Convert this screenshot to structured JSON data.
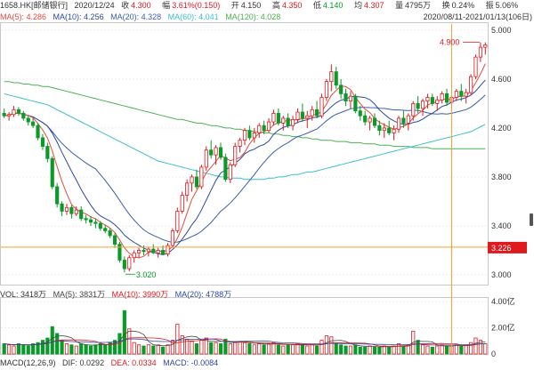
{
  "header": {
    "code": "1658.HK[邮储银行]",
    "date": "2020/12/24",
    "close_label": "收",
    "close": "4.300",
    "change_label": "幅",
    "change": "3.61%(0.150)",
    "open_label": "开",
    "open": "4.150",
    "high_label": "高",
    "high": "4.350",
    "low_label": "低",
    "low": "4.140",
    "avg_label": "均",
    "avg": "4.307",
    "volume_label": "量",
    "volume": "4795万",
    "turnover_label": "换",
    "turnover": "0.24%",
    "amplitude_label": "振",
    "amplitude": "5.06%"
  },
  "ma_legend": {
    "ma5": "MA(5): 4.286",
    "ma10": "MA(10): 4.256",
    "ma20": "MA(20): 4.328",
    "ma60": "MA(60): 4.041",
    "ma120": "MA(120): 4.028"
  },
  "range_label": "2020/08/11-2021/01/13(106日)",
  "annotations": {
    "high_label": "4.900",
    "low_label": "3.020",
    "crosshair_label": "3.226"
  },
  "vol_legend": {
    "vol": "VOL: 3418万",
    "ma5": "MA(5): 3831万",
    "ma10": "MA(10): 3990万",
    "ma20": "MA(20): 4788万"
  },
  "macd_legend": {
    "macd": "MACD(12,26,9)",
    "dif": "DIF: 0.0292",
    "dea": "DEA: 0.0334",
    "macd_val": "MACD: -0.0084"
  },
  "colors": {
    "up": "#e0191e",
    "down": "#0a9a2a",
    "ma5": "#e74c3c",
    "ma10": "#2c4aa0",
    "ma20": "#3b5fb0",
    "ma60": "#3cbfd0",
    "ma120": "#4cb050",
    "crosshair": "#f0a030"
  },
  "chart_data": {
    "type": "candlestick",
    "y_ticks": [
      "5.000",
      "4.600",
      "4.200",
      "3.800",
      "3.400",
      "3.000"
    ],
    "ylim": [
      2.92,
      5.05
    ],
    "vol_ticks": [
      "4.00亿",
      "2.00亿",
      "0"
    ],
    "vol_max": 4.6,
    "candles": [
      [
        4.32,
        4.36,
        4.28,
        4.3
      ],
      [
        4.3,
        4.33,
        4.26,
        4.31
      ],
      [
        4.31,
        4.38,
        4.29,
        4.35
      ],
      [
        4.35,
        4.37,
        4.3,
        4.32
      ],
      [
        4.32,
        4.34,
        4.26,
        4.28
      ],
      [
        4.28,
        4.3,
        4.22,
        4.25
      ],
      [
        4.25,
        4.28,
        4.2,
        4.22
      ],
      [
        4.22,
        4.24,
        4.1,
        4.12
      ],
      [
        4.12,
        4.15,
        4.02,
        4.05
      ],
      [
        4.05,
        4.08,
        3.92,
        3.95
      ],
      [
        3.95,
        3.97,
        3.7,
        3.72
      ],
      [
        3.72,
        3.75,
        3.55,
        3.58
      ],
      [
        3.58,
        3.6,
        3.48,
        3.52
      ],
      [
        3.52,
        3.58,
        3.49,
        3.55
      ],
      [
        3.55,
        3.57,
        3.46,
        3.5
      ],
      [
        3.5,
        3.56,
        3.48,
        3.53
      ],
      [
        3.53,
        3.56,
        3.44,
        3.46
      ],
      [
        3.46,
        3.49,
        3.42,
        3.45
      ],
      [
        3.45,
        3.48,
        3.4,
        3.43
      ],
      [
        3.43,
        3.46,
        3.38,
        3.42
      ],
      [
        3.42,
        3.44,
        3.36,
        3.38
      ],
      [
        3.38,
        3.41,
        3.34,
        3.36
      ],
      [
        3.36,
        3.38,
        3.3,
        3.32
      ],
      [
        3.32,
        3.34,
        3.22,
        3.25
      ],
      [
        3.25,
        3.27,
        3.1,
        3.12
      ],
      [
        3.12,
        3.15,
        3.02,
        3.05
      ],
      [
        3.05,
        3.16,
        3.03,
        3.14
      ],
      [
        3.14,
        3.2,
        3.1,
        3.18
      ],
      [
        3.18,
        3.22,
        3.14,
        3.2
      ],
      [
        3.2,
        3.24,
        3.16,
        3.19
      ],
      [
        3.19,
        3.23,
        3.15,
        3.21
      ],
      [
        3.21,
        3.25,
        3.17,
        3.18
      ],
      [
        3.18,
        3.22,
        3.14,
        3.2
      ],
      [
        3.2,
        3.24,
        3.16,
        3.17
      ],
      [
        3.17,
        3.26,
        3.15,
        3.24
      ],
      [
        3.24,
        3.38,
        3.22,
        3.36
      ],
      [
        3.36,
        3.55,
        3.34,
        3.52
      ],
      [
        3.52,
        3.68,
        3.5,
        3.65
      ],
      [
        3.65,
        3.78,
        3.6,
        3.75
      ],
      [
        3.75,
        3.82,
        3.68,
        3.8
      ],
      [
        3.8,
        3.86,
        3.7,
        3.72
      ],
      [
        3.72,
        3.9,
        3.7,
        3.88
      ],
      [
        3.88,
        4.05,
        3.85,
        4.02
      ],
      [
        4.02,
        4.1,
        3.95,
        3.98
      ],
      [
        3.98,
        4.06,
        3.9,
        4.04
      ],
      [
        4.04,
        4.08,
        3.94,
        3.96
      ],
      [
        3.96,
        3.99,
        3.76,
        3.78
      ],
      [
        3.78,
        3.92,
        3.75,
        3.9
      ],
      [
        3.9,
        4.08,
        3.88,
        4.05
      ],
      [
        4.05,
        4.12,
        4.0,
        4.1
      ],
      [
        4.1,
        4.2,
        4.06,
        4.18
      ],
      [
        4.18,
        4.22,
        4.1,
        4.12
      ],
      [
        4.12,
        4.2,
        4.08,
        4.16
      ],
      [
        4.16,
        4.24,
        4.12,
        4.22
      ],
      [
        4.22,
        4.26,
        4.15,
        4.18
      ],
      [
        4.18,
        4.28,
        4.16,
        4.25
      ],
      [
        4.25,
        4.35,
        4.22,
        4.32
      ],
      [
        4.32,
        4.36,
        4.22,
        4.24
      ],
      [
        4.24,
        4.3,
        4.18,
        4.28
      ],
      [
        4.28,
        4.32,
        4.2,
        4.22
      ],
      [
        4.22,
        4.3,
        4.18,
        4.27
      ],
      [
        4.27,
        4.36,
        4.24,
        4.33
      ],
      [
        4.33,
        4.4,
        4.25,
        4.28
      ],
      [
        4.28,
        4.34,
        4.2,
        4.3
      ],
      [
        4.3,
        4.38,
        4.26,
        4.35
      ],
      [
        4.35,
        4.42,
        4.28,
        4.3
      ],
      [
        4.3,
        4.48,
        4.28,
        4.45
      ],
      [
        4.45,
        4.6,
        4.42,
        4.58
      ],
      [
        4.58,
        4.72,
        4.5,
        4.66
      ],
      [
        4.66,
        4.7,
        4.52,
        4.55
      ],
      [
        4.55,
        4.6,
        4.44,
        4.48
      ],
      [
        4.48,
        4.52,
        4.38,
        4.42
      ],
      [
        4.42,
        4.5,
        4.36,
        4.46
      ],
      [
        4.46,
        4.48,
        4.32,
        4.34
      ],
      [
        4.34,
        4.38,
        4.26,
        4.3
      ],
      [
        4.3,
        4.34,
        4.22,
        4.25
      ],
      [
        4.25,
        4.3,
        4.18,
        4.28
      ],
      [
        4.28,
        4.32,
        4.2,
        4.22
      ],
      [
        4.22,
        4.26,
        4.14,
        4.18
      ],
      [
        4.18,
        4.24,
        4.12,
        4.2
      ],
      [
        4.2,
        4.26,
        4.14,
        4.16
      ],
      [
        4.16,
        4.22,
        4.1,
        4.19
      ],
      [
        4.19,
        4.3,
        4.16,
        4.28
      ],
      [
        4.28,
        4.34,
        4.2,
        4.24
      ],
      [
        4.24,
        4.32,
        4.18,
        4.3
      ],
      [
        4.3,
        4.42,
        4.26,
        4.4
      ],
      [
        4.4,
        4.46,
        4.32,
        4.36
      ],
      [
        4.36,
        4.44,
        4.3,
        4.42
      ],
      [
        4.42,
        4.48,
        4.36,
        4.45
      ],
      [
        4.45,
        4.48,
        4.38,
        4.4
      ],
      [
        4.4,
        4.46,
        4.34,
        4.43
      ],
      [
        4.43,
        4.5,
        4.4,
        4.48
      ],
      [
        4.48,
        4.52,
        4.38,
        4.41
      ],
      [
        4.41,
        4.47,
        4.36,
        4.45
      ],
      [
        4.45,
        4.52,
        4.42,
        4.5
      ],
      [
        4.5,
        4.56,
        4.42,
        4.46
      ],
      [
        4.46,
        4.52,
        4.4,
        4.49
      ],
      [
        4.49,
        4.64,
        4.47,
        4.62
      ],
      [
        4.62,
        4.8,
        4.6,
        4.78
      ],
      [
        4.78,
        4.9,
        4.74,
        4.86
      ],
      [
        4.86,
        4.9,
        4.8,
        4.88
      ]
    ],
    "volumes": [
      0.9,
      0.8,
      0.7,
      0.9,
      0.8,
      0.7,
      0.9,
      1.0,
      1.2,
      1.4,
      2.4,
      1.8,
      1.2,
      0.9,
      0.8,
      0.7,
      0.9,
      0.8,
      0.7,
      0.8,
      0.9,
      0.8,
      1.0,
      1.2,
      1.8,
      3.8,
      2.2,
      1.0,
      0.8,
      0.7,
      0.8,
      0.7,
      0.8,
      0.6,
      0.8,
      1.2,
      2.6,
      1.6,
      1.3,
      1.1,
      0.9,
      1.2,
      1.4,
      1.0,
      1.0,
      0.9,
      1.3,
      0.9,
      1.0,
      1.1,
      1.0,
      0.9,
      0.8,
      0.9,
      0.8,
      0.9,
      1.0,
      0.8,
      0.7,
      0.8,
      0.8,
      0.9,
      0.8,
      0.7,
      0.8,
      0.7,
      1.2,
      1.6,
      1.5,
      0.9,
      0.8,
      0.7,
      0.7,
      0.8,
      0.6,
      0.6,
      0.7,
      0.6,
      0.6,
      0.7,
      0.6,
      0.7,
      0.9,
      0.7,
      0.8,
      2.0,
      1.2,
      0.8,
      0.7,
      0.6,
      0.7,
      0.8,
      0.7,
      0.7,
      0.8,
      0.7,
      0.8,
      1.0,
      1.4,
      1.2,
      0.9
    ],
    "ma60": [
      4.48,
      4.47,
      4.46,
      4.45,
      4.44,
      4.43,
      4.42,
      4.41,
      4.4,
      4.39,
      4.37,
      4.35,
      4.33,
      4.31,
      4.29,
      4.27,
      4.25,
      4.23,
      4.21,
      4.19,
      4.17,
      4.15,
      4.13,
      4.11,
      4.09,
      4.07,
      4.05,
      4.03,
      4.01,
      3.99,
      3.97,
      3.95,
      3.93,
      3.92,
      3.91,
      3.9,
      3.89,
      3.88,
      3.87,
      3.86,
      3.85,
      3.84,
      3.83,
      3.82,
      3.81,
      3.8,
      3.8,
      3.79,
      3.79,
      3.79,
      3.78,
      3.78,
      3.78,
      3.78,
      3.78,
      3.79,
      3.79,
      3.8,
      3.8,
      3.81,
      3.82,
      3.82,
      3.83,
      3.84,
      3.84,
      3.85,
      3.86,
      3.87,
      3.88,
      3.89,
      3.9,
      3.91,
      3.92,
      3.93,
      3.94,
      3.95,
      3.96,
      3.97,
      3.98,
      3.99,
      4.0,
      4.01,
      4.02,
      4.03,
      4.04,
      4.05,
      4.06,
      4.07,
      4.08,
      4.09,
      4.1,
      4.11,
      4.12,
      4.13,
      4.14,
      4.15,
      4.16,
      4.17,
      4.19,
      4.21,
      4.23
    ],
    "ma120": [
      4.58,
      4.58,
      4.57,
      4.57,
      4.56,
      4.56,
      4.55,
      4.55,
      4.54,
      4.54,
      4.53,
      4.52,
      4.51,
      4.5,
      4.49,
      4.48,
      4.47,
      4.46,
      4.45,
      4.44,
      4.43,
      4.42,
      4.41,
      4.4,
      4.39,
      4.38,
      4.37,
      4.36,
      4.35,
      4.34,
      4.33,
      4.32,
      4.31,
      4.3,
      4.29,
      4.28,
      4.27,
      4.27,
      4.26,
      4.25,
      4.24,
      4.24,
      4.23,
      4.22,
      4.22,
      4.21,
      4.2,
      4.2,
      4.19,
      4.19,
      4.18,
      4.18,
      4.17,
      4.17,
      4.16,
      4.16,
      4.15,
      4.15,
      4.14,
      4.14,
      4.13,
      4.13,
      4.12,
      4.12,
      4.11,
      4.11,
      4.1,
      4.1,
      4.1,
      4.09,
      4.09,
      4.09,
      4.08,
      4.08,
      4.08,
      4.07,
      4.07,
      4.07,
      4.06,
      4.06,
      4.06,
      4.05,
      4.05,
      4.05,
      4.05,
      4.04,
      4.04,
      4.04,
      4.04,
      4.03,
      4.03,
      4.03,
      4.03,
      4.03,
      4.03,
      4.03,
      4.03,
      4.03,
      4.03,
      4.03,
      4.03
    ]
  }
}
